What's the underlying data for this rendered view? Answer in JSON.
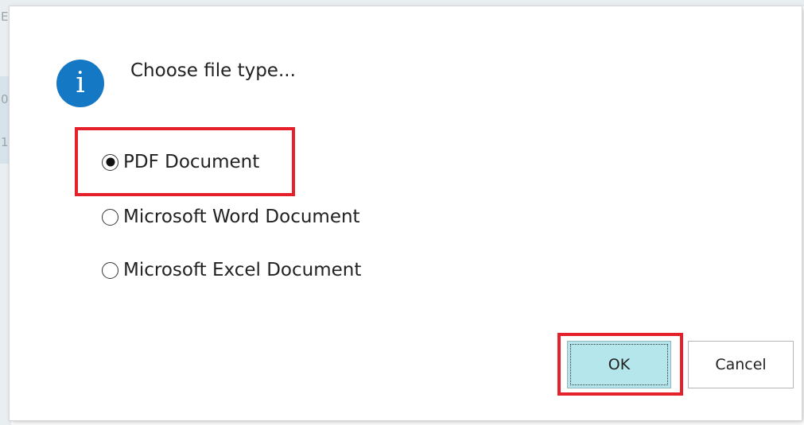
{
  "background": {
    "peek_chars": [
      "E",
      "0",
      "1"
    ]
  },
  "dialog": {
    "icon": "info-icon",
    "icon_glyph": "i",
    "title": "Choose file type...",
    "options": [
      {
        "label": "PDF Document",
        "selected": true
      },
      {
        "label": "Microsoft Word Document",
        "selected": false
      },
      {
        "label": "Microsoft Excel Document",
        "selected": false
      }
    ],
    "buttons": {
      "ok_label": "OK",
      "cancel_label": "Cancel"
    }
  },
  "colors": {
    "icon_blue": "#1578c4",
    "highlight_red": "#e5202a",
    "ok_button_bg": "#b4e6ec"
  }
}
